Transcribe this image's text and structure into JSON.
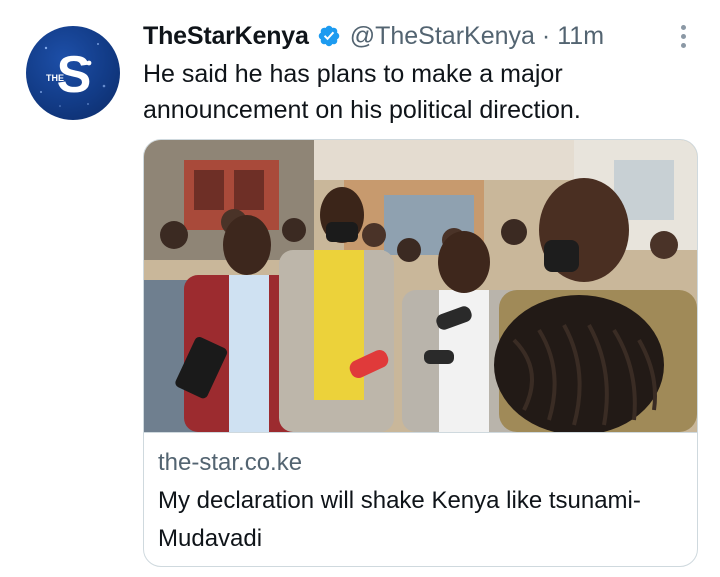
{
  "account": {
    "display_name": "TheStarKenya",
    "handle": "@TheStarKenya",
    "separator": "·",
    "time": "11m",
    "verified": true,
    "avatar_letter": "S",
    "avatar_small_text": "THE"
  },
  "tweet": {
    "text": "He said he has plans to make a major announcement on his political direction."
  },
  "card": {
    "domain": "the-star.co.ke",
    "title": "My declaration will shake Kenya like tsunami- Mudavadi",
    "image_icon": "press-conference-photo"
  },
  "icons": {
    "verified": "verified-badge-icon",
    "more": "more-options-icon"
  },
  "colors": {
    "verified_blue": "#1d9bf0",
    "secondary_text": "#536471",
    "avatar_blue": "#123b86"
  }
}
